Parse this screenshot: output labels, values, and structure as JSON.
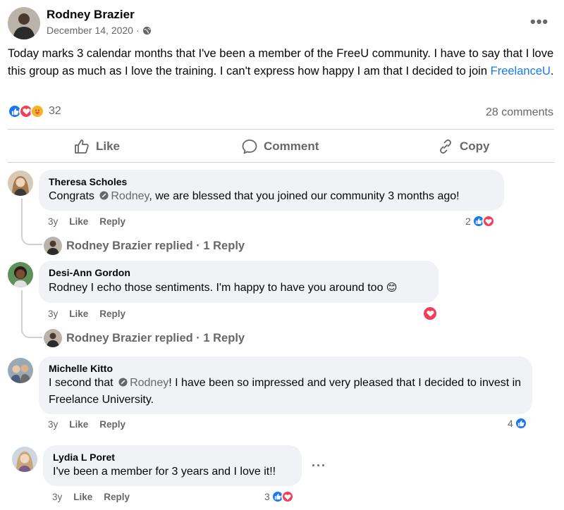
{
  "post": {
    "author": "Rodney Brazier",
    "date": "December 14, 2020",
    "date_separator": "·",
    "more_menu": "•••",
    "text_main": "Today marks 3 calendar months that I've been a member of the FreeU community. I have to say that I love this group as much as I love the training. I can't express how happy I am that I decided to join ",
    "text_link": "FreelanceU",
    "text_end": ".",
    "reaction_count": "32",
    "comments_count": "28 comments",
    "reaction_icons": [
      "like-icon",
      "love-icon",
      "care-icon"
    ]
  },
  "actions": {
    "like": "Like",
    "comment": "Comment",
    "copy": "Copy"
  },
  "comments": [
    {
      "name": "Theresa Scholes",
      "text_before": "Congrats ",
      "mention": "Rodney",
      "text_after": ", we are blessed that you joined our community 3 months ago!",
      "age": "3y",
      "like": "Like",
      "reply": "Reply",
      "reaction_count": "2",
      "replied": "Rodney Brazier replied · 1 Reply"
    },
    {
      "name": "Desi-Ann Gordon",
      "text": "Rodney I echo those sentiments. I'm happy to have you around too",
      "emoji": "😊",
      "age": "3y",
      "like": "Like",
      "reply": "Reply",
      "replied": "Rodney Brazier replied · 1 Reply"
    },
    {
      "name": "Michelle Kitto",
      "text_before": "I second that ",
      "mention": "Rodney",
      "text_after": "! I have been so impressed and very pleased that I decided to invest in Freelance University.",
      "age": "3y",
      "like": "Like",
      "reply": "Reply",
      "reaction_count": "4"
    },
    {
      "name": "Lydia L Poret",
      "text": "I've been a member for 3 years and I love it!!",
      "more_menu": "···",
      "age": "3y",
      "like": "Like",
      "reply": "Reply",
      "reaction_count": "3"
    }
  ],
  "colors": {
    "like_blue": "#1877f2",
    "love_red": "#f33e58",
    "care_yellow": "#f7b125",
    "muted": "#65676b",
    "bubble": "#f0f2f5"
  }
}
